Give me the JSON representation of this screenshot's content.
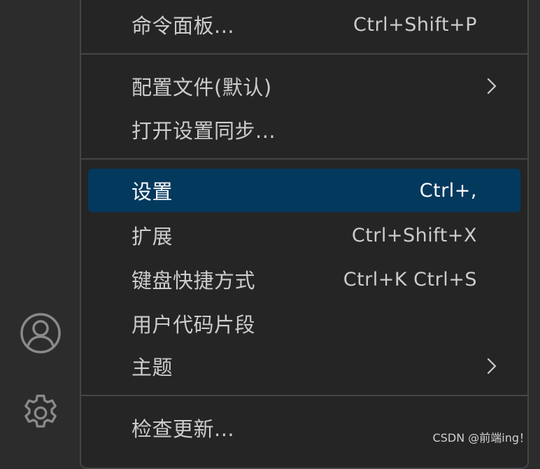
{
  "colors": {
    "background": "#2c2c2c",
    "menu_background": "#252526",
    "menu_border": "#454545",
    "active_background": "#04395e",
    "text": "#cccccc",
    "active_text": "#ffffff"
  },
  "activity_bar": {
    "icons": [
      "account-icon",
      "gear-icon"
    ]
  },
  "menu": {
    "items": [
      {
        "label": "命令面板...",
        "shortcut": "Ctrl+Shift+P"
      },
      {
        "label": "配置文件(默认)",
        "submenu_icon": "chevron-right-icon"
      },
      {
        "label": "打开设置同步..."
      },
      {
        "label": "设置",
        "shortcut": "Ctrl+,",
        "active": true
      },
      {
        "label": "扩展",
        "shortcut": "Ctrl+Shift+X"
      },
      {
        "label": "键盘快捷方式",
        "shortcut": "Ctrl+K Ctrl+S"
      },
      {
        "label": "用户代码片段"
      },
      {
        "label": "主题",
        "submenu_icon": "chevron-right-icon"
      },
      {
        "label": "检查更新..."
      }
    ]
  },
  "watermark": "CSDN @前端ing！"
}
